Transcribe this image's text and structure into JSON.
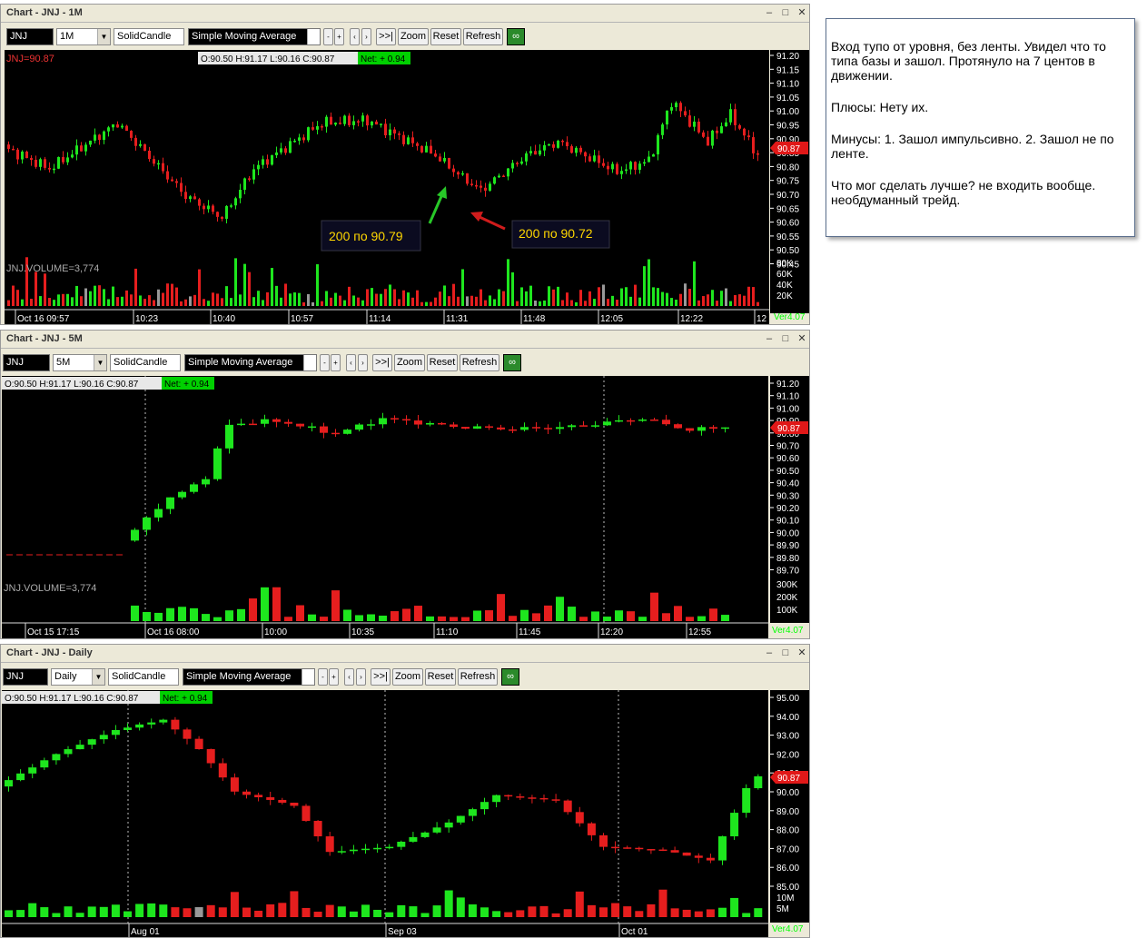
{
  "windows": [
    {
      "title": "Chart - JNJ - 1M",
      "symbol": "JNJ",
      "interval": "1M",
      "style": "SolidCandle",
      "indicator": "Simple Moving Average",
      "buttons": {
        "minus": "-",
        "plus": "+",
        "prev": "‹",
        "next": "›",
        "end": ">>|",
        "zoom": "Zoom",
        "reset": "Reset",
        "refresh": "Refresh"
      },
      "symbol_price": "JNJ=90.87",
      "ohlc": "O:90.50 H:91.17 L:90.16 C:90.87",
      "net": "Net: + 0.94",
      "volume_label": "JNJ.VOLUME=3,774",
      "price_tag": "90.87",
      "version": "Ver4.07",
      "price_ticks": [
        "91.20",
        "91.15",
        "91.10",
        "91.05",
        "91.00",
        "90.95",
        "90.90",
        "90.85",
        "90.80",
        "90.75",
        "90.70",
        "90.65",
        "90.60",
        "90.55",
        "90.50",
        "90.45"
      ],
      "volume_ticks": [
        "80K",
        "60K",
        "40K",
        "20K"
      ],
      "time_ticks": [
        "Oct 16 09:57",
        "10:23",
        "10:40",
        "10:57",
        "11:14",
        "11:31",
        "11:48",
        "12:05",
        "12:22",
        "12"
      ],
      "annotations": [
        {
          "text": "200 по 90.79",
          "color": "#28c828"
        },
        {
          "text": "200 по 90.72",
          "color": "#d01c1c"
        }
      ]
    },
    {
      "title": "Chart - JNJ - 5M",
      "symbol": "JNJ",
      "interval": "5M",
      "style": "SolidCandle",
      "indicator": "Simple Moving Average",
      "buttons": {
        "minus": "-",
        "plus": "+",
        "prev": "‹",
        "next": "›",
        "end": ">>|",
        "zoom": "Zoom",
        "reset": "Reset",
        "refresh": "Refresh"
      },
      "ohlc": "O:90.50 H:91.17 L:90.16 C:90.87",
      "net": "Net: + 0.94",
      "volume_label": "JNJ.VOLUME=3,774",
      "price_tag": "90.87",
      "version": "Ver4.07",
      "price_ticks": [
        "91.20",
        "91.10",
        "91.00",
        "90.90",
        "90.80",
        "90.70",
        "90.60",
        "90.50",
        "90.40",
        "90.30",
        "90.20",
        "90.10",
        "90.00",
        "89.90",
        "89.80",
        "89.70"
      ],
      "volume_ticks": [
        "300K",
        "200K",
        "100K"
      ],
      "time_ticks": [
        "Oct 15 17:15",
        "Oct 16 08:00",
        "10:00",
        "10:35",
        "11:10",
        "11:45",
        "12:20",
        "12:55"
      ]
    },
    {
      "title": "Chart - JNJ - Daily",
      "symbol": "JNJ",
      "interval": "Daily",
      "style": "SolidCandle",
      "indicator": "Simple Moving Average",
      "buttons": {
        "minus": "-",
        "plus": "+",
        "prev": "‹",
        "next": "›",
        "end": ">>|",
        "zoom": "Zoom",
        "reset": "Reset",
        "refresh": "Refresh"
      },
      "ohlc": "O:90.50 H:91.17 L:90.16 C:90.87",
      "net": "Net: + 0.94",
      "price_tag": "90.87",
      "version": "Ver4.07",
      "price_ticks": [
        "95.00",
        "94.00",
        "93.00",
        "92.00",
        "91.00",
        "90.00",
        "89.00",
        "88.00",
        "87.00",
        "86.00",
        "85.00"
      ],
      "volume_ticks": [
        "10M",
        "5M"
      ],
      "time_ticks": [
        "Aug 01",
        "Sep 03",
        "Oct 01"
      ]
    }
  ],
  "colors": {
    "up": "#1ee61e",
    "down": "#e61e1e",
    "tag": "#e01818",
    "net": "#00d000"
  },
  "note": {
    "p1": "Вход тупо от уровня, без ленты. Увидел что то типа базы и зашол. Протянуло на 7 центов в движении.",
    "p2": "Плюсы: Нету их.",
    "p3": "Минусы: 1. Зашол импульсивно. 2. Зашол не по ленте.",
    "p4": "Что мог сделать лучше? не входить вообще. необдуманный трейд."
  }
}
